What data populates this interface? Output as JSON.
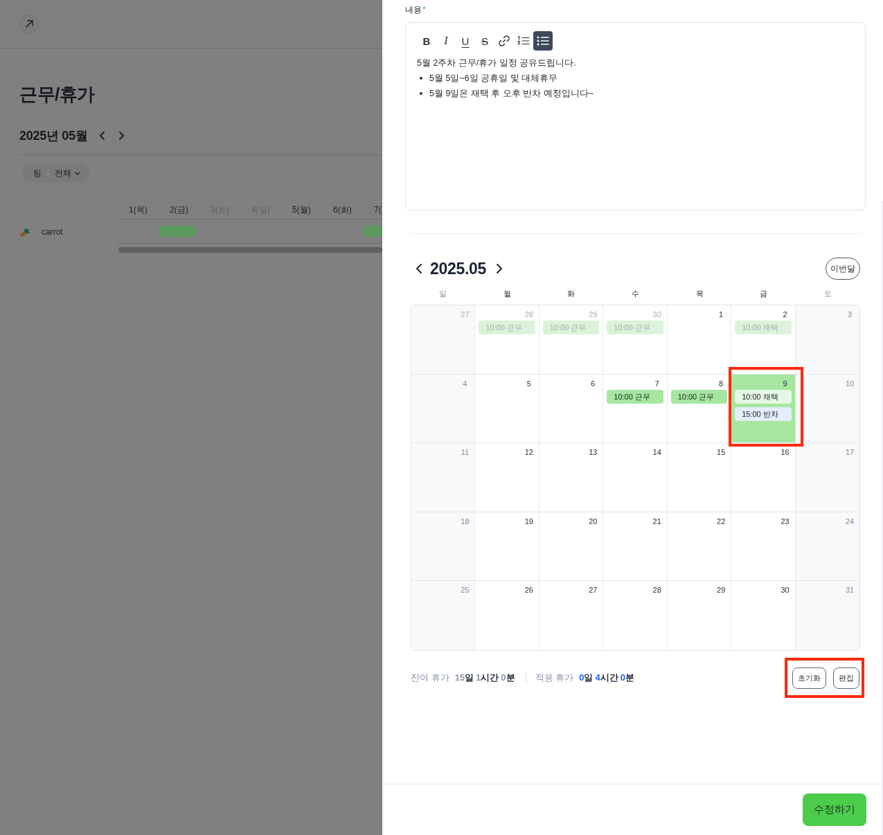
{
  "left_page": {
    "title": "근무/휴가",
    "month": "2025년 05월",
    "filter": {
      "label": "팀",
      "value": "전체"
    },
    "timeline": {
      "days": [
        {
          "label": "1(목)",
          "weekend": false
        },
        {
          "label": "2(금)",
          "weekend": false
        },
        {
          "label": "3(토)",
          "weekend": true
        },
        {
          "label": "4(일)",
          "weekend": true
        },
        {
          "label": "5(월)",
          "weekend": false
        },
        {
          "label": "6(화)",
          "weekend": false
        },
        {
          "label": "7(",
          "weekend": false
        }
      ],
      "members": [
        {
          "name": "carrot",
          "shifts": [
            {
              "booked": false
            },
            {
              "booked": true
            },
            {
              "booked": false
            },
            {
              "booked": false
            },
            {
              "booked": false
            },
            {
              "booked": false
            },
            {
              "booked": true
            }
          ]
        }
      ]
    }
  },
  "editor": {
    "label": "내용",
    "required_mark": "*",
    "toolbar": [
      {
        "kind": "bold",
        "glyph": "B",
        "active": false
      },
      {
        "kind": "italic",
        "glyph": "I",
        "active": false
      },
      {
        "kind": "underline",
        "glyph": "U",
        "active": false
      },
      {
        "kind": "strike",
        "glyph": "S",
        "active": false
      },
      {
        "kind": "link",
        "active": false
      },
      {
        "kind": "ordered_list",
        "active": false
      },
      {
        "kind": "bullet_list",
        "active": true
      }
    ],
    "content": [
      {
        "kind": "paragraph",
        "text": "5월 2주차 근무/휴가 일정 공유드립니다."
      },
      {
        "kind": "bullet",
        "text": "5월 5일~6일 공휴일 및 대체휴무"
      },
      {
        "kind": "bullet",
        "text": "5월 9일은 재택 후 오후 반차 예정입니다~"
      }
    ]
  },
  "calendar": {
    "title": "2025.05",
    "today_button": "이번달",
    "weekdays": [
      {
        "label": "일",
        "weekend": true
      },
      {
        "label": "월",
        "weekend": false
      },
      {
        "label": "화",
        "weekend": false
      },
      {
        "label": "수",
        "weekend": false
      },
      {
        "label": "목",
        "weekend": false
      },
      {
        "label": "금",
        "weekend": false
      },
      {
        "label": "토",
        "weekend": true
      }
    ],
    "weeks": [
      [
        {
          "day": "27",
          "outside": true,
          "selected": false,
          "highlighted": false
        },
        {
          "day": "28",
          "outside": true,
          "selected": false,
          "highlighted": false,
          "events": [
            {
              "label": "10:00 근무",
              "kind": "work",
              "past": true
            }
          ]
        },
        {
          "day": "29",
          "outside": true,
          "selected": false,
          "highlighted": false,
          "events": [
            {
              "label": "10:00 근무",
              "kind": "work",
              "past": true
            }
          ]
        },
        {
          "day": "30",
          "outside": true,
          "selected": false,
          "highlighted": false,
          "events": [
            {
              "label": "10:00 근무",
              "kind": "work",
              "past": true
            }
          ]
        },
        {
          "day": "1",
          "outside": false,
          "selected": false,
          "highlighted": false
        },
        {
          "day": "2",
          "outside": false,
          "selected": false,
          "highlighted": false,
          "events": [
            {
              "label": "10:00 재택",
              "kind": "remote",
              "past": true
            }
          ]
        },
        {
          "day": "3",
          "outside": false,
          "selected": false,
          "highlighted": false
        }
      ],
      [
        {
          "day": "4",
          "outside": false,
          "selected": false,
          "highlighted": false
        },
        {
          "day": "5",
          "outside": false,
          "selected": false,
          "highlighted": false
        },
        {
          "day": "6",
          "outside": false,
          "selected": false,
          "highlighted": false
        },
        {
          "day": "7",
          "outside": false,
          "selected": false,
          "highlighted": false,
          "events": [
            {
              "label": "10:00 근무",
              "kind": "work",
              "past": false
            }
          ]
        },
        {
          "day": "8",
          "outside": false,
          "selected": false,
          "highlighted": false,
          "events": [
            {
              "label": "10:00 근무",
              "kind": "work",
              "past": false
            }
          ]
        },
        {
          "day": "9",
          "outside": false,
          "selected": true,
          "highlighted": true,
          "events": [
            {
              "label": "10:00 재택",
              "kind": "remote",
              "past": false
            },
            {
              "label": "15:00 반차",
              "kind": "half",
              "past": false
            }
          ]
        },
        {
          "day": "10",
          "outside": false,
          "selected": false,
          "highlighted": false
        }
      ],
      [
        {
          "day": "11",
          "outside": false,
          "selected": false,
          "highlighted": false
        },
        {
          "day": "12",
          "outside": false,
          "selected": false,
          "highlighted": false
        },
        {
          "day": "13",
          "outside": false,
          "selected": false,
          "highlighted": false
        },
        {
          "day": "14",
          "outside": false,
          "selected": false,
          "highlighted": false
        },
        {
          "day": "15",
          "outside": false,
          "selected": false,
          "highlighted": false
        },
        {
          "day": "16",
          "outside": false,
          "selected": false,
          "highlighted": false
        },
        {
          "day": "17",
          "outside": false,
          "selected": false,
          "highlighted": false
        }
      ],
      [
        {
          "day": "18",
          "outside": false,
          "selected": false,
          "highlighted": false
        },
        {
          "day": "19",
          "outside": false,
          "selected": false,
          "highlighted": false
        },
        {
          "day": "20",
          "outside": false,
          "selected": false,
          "highlighted": false
        },
        {
          "day": "21",
          "outside": false,
          "selected": false,
          "highlighted": false
        },
        {
          "day": "22",
          "outside": false,
          "selected": false,
          "highlighted": false
        },
        {
          "day": "23",
          "outside": false,
          "selected": false,
          "highlighted": false
        },
        {
          "day": "24",
          "outside": false,
          "selected": false,
          "highlighted": false
        }
      ],
      [
        {
          "day": "25",
          "outside": false,
          "selected": false,
          "highlighted": false
        },
        {
          "day": "26",
          "outside": false,
          "selected": false,
          "highlighted": false
        },
        {
          "day": "27",
          "outside": false,
          "selected": false,
          "highlighted": false
        },
        {
          "day": "28",
          "outside": false,
          "selected": false,
          "highlighted": false
        },
        {
          "day": "29",
          "outside": false,
          "selected": false,
          "highlighted": false
        },
        {
          "day": "30",
          "outside": false,
          "selected": false,
          "highlighted": false
        },
        {
          "day": "31",
          "outside": false,
          "selected": false,
          "highlighted": false
        }
      ]
    ]
  },
  "leave": {
    "items": [
      {
        "kind": "remaining",
        "label": "잔여 휴가",
        "parts": [
          {
            "value": "15",
            "unit": "일"
          },
          {
            "value": "1",
            "unit": "시간"
          },
          {
            "value": "0",
            "unit": "분"
          }
        ]
      },
      {
        "kind": "applied",
        "label": "적용 휴가",
        "parts": [
          {
            "value": "0",
            "unit": "일"
          },
          {
            "value": "4",
            "unit": "시간"
          },
          {
            "value": "0",
            "unit": "분"
          }
        ]
      }
    ],
    "actions": [
      {
        "label": "초기화"
      },
      {
        "label": "편집"
      }
    ],
    "actions_highlighted": true
  },
  "submit_button": "수정하기"
}
